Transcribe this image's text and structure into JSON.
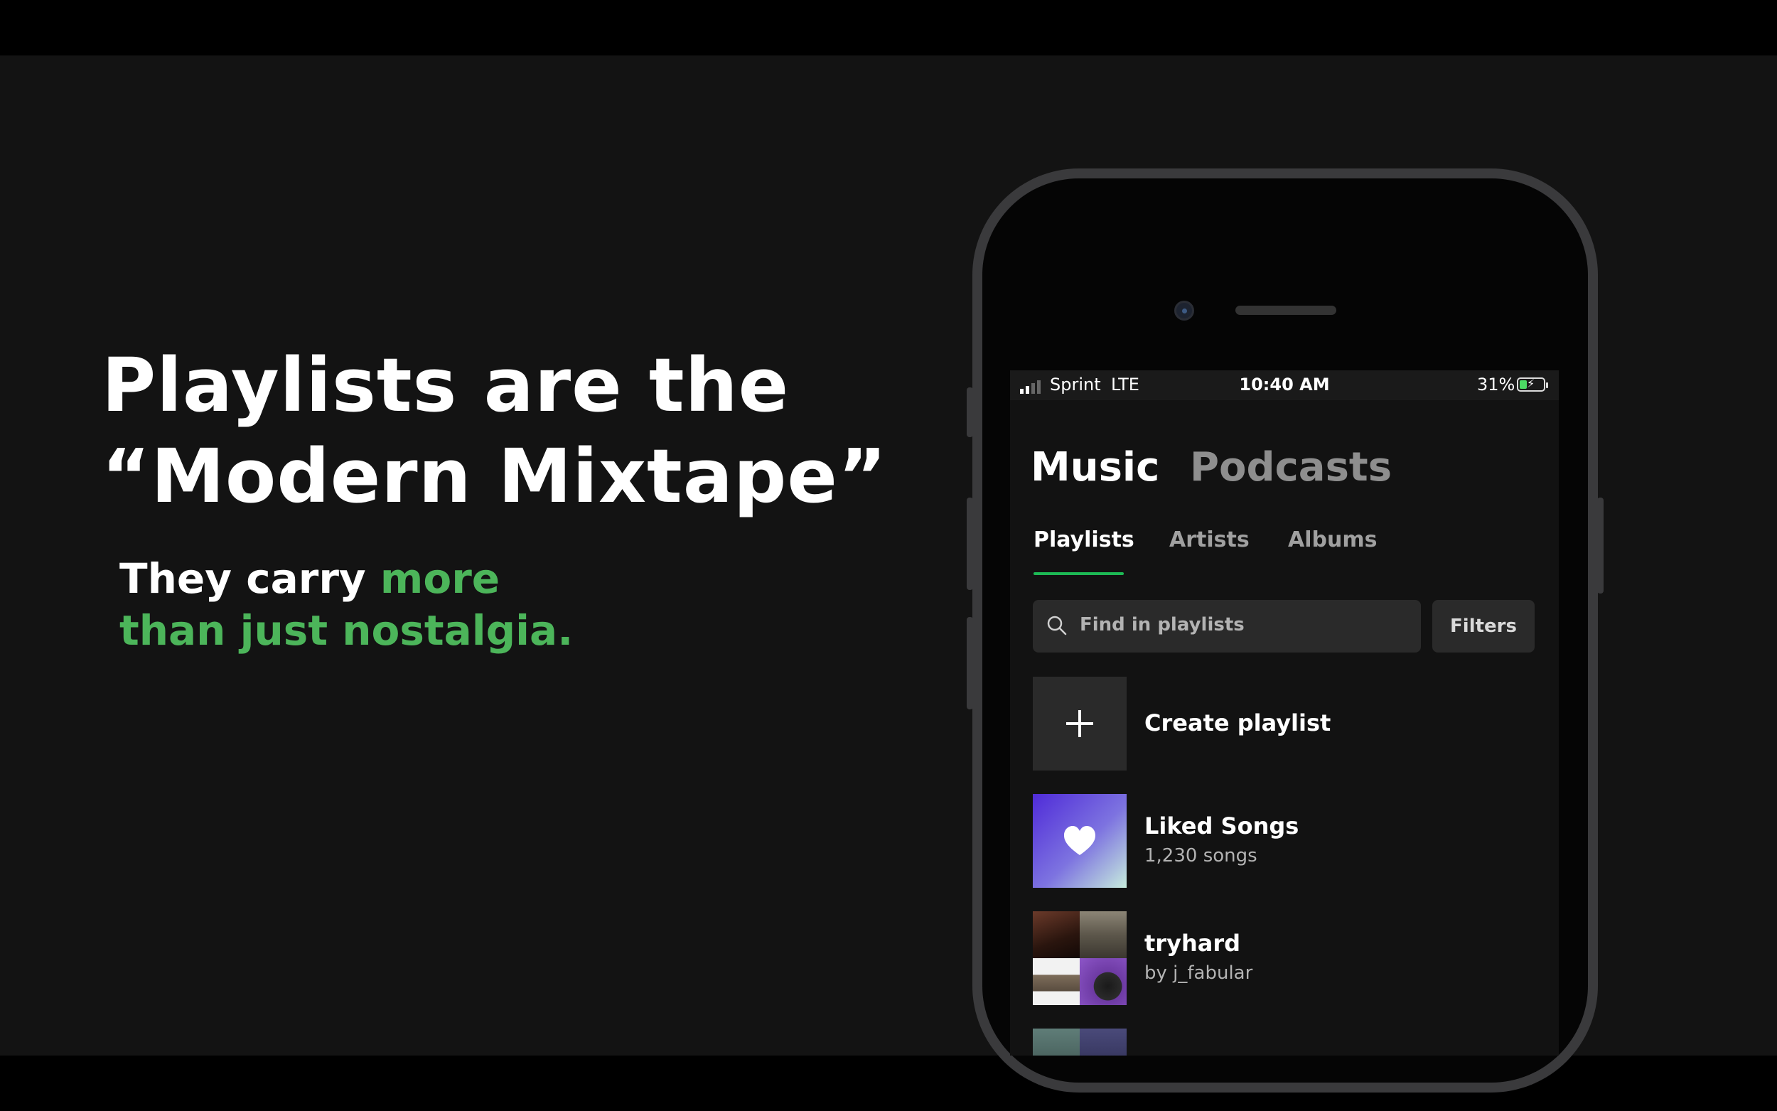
{
  "slide": {
    "headline_line1": "Playlists are the",
    "headline_line2": "“Modern Mixtape”",
    "sub_part1": "They carry ",
    "sub_part2": "more",
    "sub_part3": "than just nostalgia.",
    "accent_color": "#4cb55a"
  },
  "phone": {
    "status": {
      "carrier": "Sprint",
      "network": "LTE",
      "time": "10:40 AM",
      "battery_percent_label": "31%",
      "battery_level": 0.31,
      "charging_icon": "bolt-icon"
    },
    "top_tabs": {
      "music": "Music",
      "podcasts": "Podcasts",
      "active": "Music"
    },
    "sub_tabs": {
      "playlists": "Playlists",
      "artists": "Artists",
      "albums": "Albums",
      "active": "Playlists",
      "active_underline_color": "#1db954"
    },
    "search": {
      "placeholder": "Find in playlists",
      "icon": "search-icon"
    },
    "filters_label": "Filters",
    "library": [
      {
        "title": "Create playlist",
        "subtitle": "",
        "icon": "plus-icon"
      },
      {
        "title": "Liked Songs",
        "subtitle": "1,230 songs",
        "icon": "heart-icon"
      },
      {
        "title": "tryhard",
        "subtitle": "by j_fabular",
        "icon": "album-mosaic"
      }
    ]
  }
}
